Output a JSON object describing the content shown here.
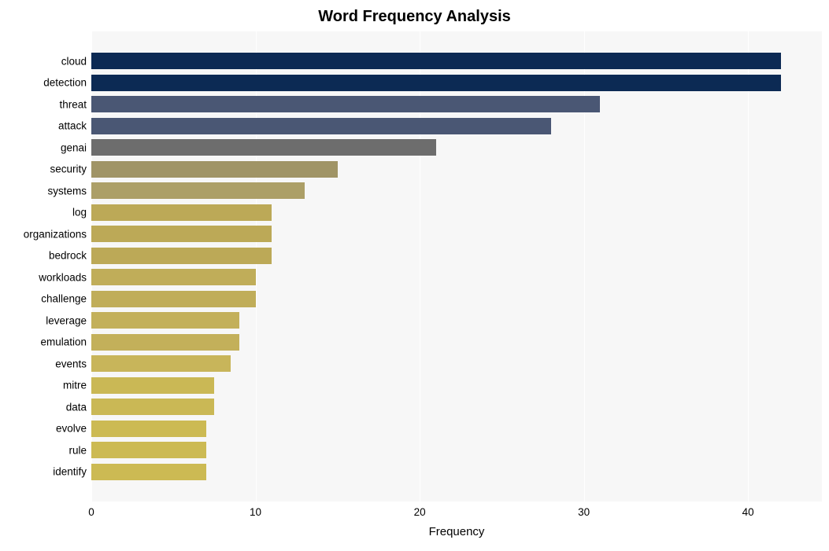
{
  "chart_data": {
    "type": "bar",
    "orientation": "horizontal",
    "title": "Word Frequency Analysis",
    "xlabel": "Frequency",
    "ylabel": "",
    "xlim": [
      0,
      44.5
    ],
    "xticks": [
      0,
      10,
      20,
      30,
      40
    ],
    "categories": [
      "cloud",
      "detection",
      "threat",
      "attack",
      "genai",
      "security",
      "systems",
      "log",
      "organizations",
      "bedrock",
      "workloads",
      "challenge",
      "leverage",
      "emulation",
      "events",
      "mitre",
      "data",
      "evolve",
      "rule",
      "identify"
    ],
    "values": [
      42,
      42,
      31,
      28,
      21,
      15,
      13,
      11,
      11,
      11,
      10,
      10,
      9,
      9,
      8.5,
      7.5,
      7.5,
      7,
      7,
      7
    ],
    "colors": [
      "#0c2a54",
      "#0c2a54",
      "#4a5774",
      "#4a5774",
      "#6d6d6d",
      "#a09466",
      "#ac9f67",
      "#bca957",
      "#bca957",
      "#bca957",
      "#c0ad59",
      "#c0ad59",
      "#c3b05a",
      "#c3b05a",
      "#c8b55a",
      "#cab855",
      "#cab855",
      "#ccba53",
      "#ccba53",
      "#ccba53"
    ]
  }
}
